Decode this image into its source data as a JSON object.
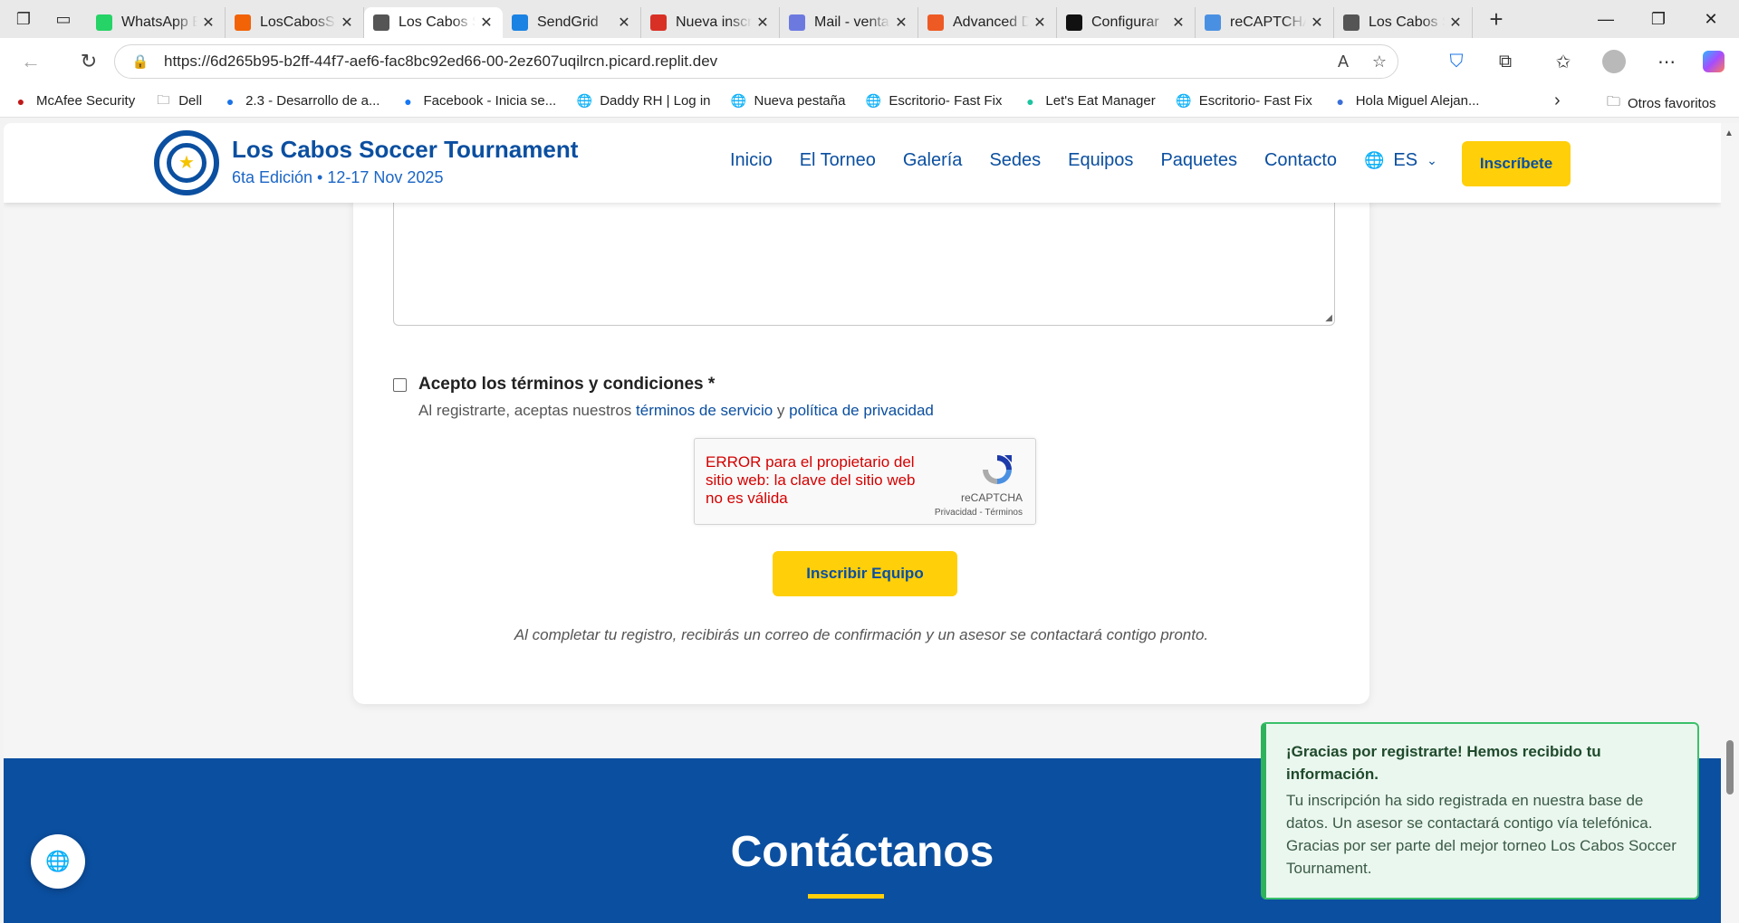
{
  "browser": {
    "tabs": [
      {
        "title": "WhatsApp Business",
        "icon": "whatsapp-icon",
        "color": "#25d366",
        "active": false
      },
      {
        "title": "LosCabosSoccer",
        "icon": "replit-icon",
        "color": "#f26207",
        "active": false
      },
      {
        "title": "Los Cabos Soccer",
        "icon": "globe-icon",
        "color": "#555555",
        "active": true
      },
      {
        "title": "SendGrid",
        "icon": "sendgrid-icon",
        "color": "#1a82e2",
        "active": false
      },
      {
        "title": "Nueva inscripción",
        "icon": "gmail-icon",
        "color": "#d93025",
        "active": false
      },
      {
        "title": "Mail - ventas",
        "icon": "mail-icon",
        "color": "#6c7ae0",
        "active": false
      },
      {
        "title": "Advanced Design",
        "icon": "advanced-icon",
        "color": "#ee5a24",
        "active": false
      },
      {
        "title": "Configurar",
        "icon": "openai-icon",
        "color": "#111111",
        "active": false
      },
      {
        "title": "reCAPTCHA",
        "icon": "recaptcha-icon",
        "color": "#4a90e2",
        "active": false
      },
      {
        "title": "Los Cabos Soccer",
        "icon": "globe-icon",
        "color": "#555555",
        "active": false
      }
    ],
    "url": "https://6d265b95-b2ff-44f7-aef6-fac8bc92ed66-00-2ez607uqilrcn.picard.replit.dev",
    "favorites": [
      {
        "label": "McAfee Security",
        "icon": "mcafee-icon",
        "color": "#c01818"
      },
      {
        "label": "Dell",
        "icon": "folder-icon",
        "color": "#444444"
      },
      {
        "label": "2.3 - Desarrollo de a...",
        "icon": "loading-icon",
        "color": "#1a73e8"
      },
      {
        "label": "Facebook - Inicia se...",
        "icon": "facebook-icon",
        "color": "#1877f2"
      },
      {
        "label": "Daddy RH | Log in",
        "icon": "globe-icon",
        "color": "#444444"
      },
      {
        "label": "Nueva pestaña",
        "icon": "globe-icon",
        "color": "#444444"
      },
      {
        "label": "Escritorio- Fast Fix",
        "icon": "globe-icon",
        "color": "#444444"
      },
      {
        "label": "Let's Eat Manager",
        "icon": "lets-eat-icon",
        "color": "#1cc4a0"
      },
      {
        "label": "Escritorio- Fast Fix",
        "icon": "globe-icon",
        "color": "#444444"
      },
      {
        "label": "Hola Miguel Alejan...",
        "icon": "hola-icon",
        "color": "#3b6fd8"
      }
    ],
    "other_favorites": "Otros favoritos"
  },
  "site": {
    "brand_title": "Los Cabos Soccer Tournament",
    "brand_sub": "6ta Edición • 12-17 Nov 2025",
    "nav": [
      "Inicio",
      "El Torneo",
      "Galería",
      "Sedes",
      "Equipos",
      "Paquetes",
      "Contacto"
    ],
    "lang": "ES",
    "cta": "Inscríbete",
    "accent_blue": "#0b4fa0",
    "accent_yellow": "#ffcf0a"
  },
  "form": {
    "terms_label": "Acepto los términos y condiciones *",
    "terms_help_prefix": "Al registrarte, aceptas nuestros ",
    "terms_link": "términos de servicio",
    "terms_join": " y ",
    "privacy_link": "política de privacidad",
    "recaptcha_error": "ERROR para el propietario del sitio web: la clave del sitio web no es válida",
    "recaptcha_name": "reCAPTCHA",
    "recaptcha_links": "Privacidad - Términos",
    "submit": "Inscribir Equipo",
    "note": "Al completar tu registro, recibirás un correo de confirmación y un asesor se contactará contigo pronto."
  },
  "contact": {
    "title": "Contáctanos"
  },
  "toast": {
    "title": "¡Gracias por registrarte! Hemos recibido tu información.",
    "body": "Tu inscripción ha sido registrada en nuestra base de datos. Un asesor se contactará contigo vía telefónica. Gracias por ser parte del mejor torneo Los Cabos Soccer Tournament."
  }
}
